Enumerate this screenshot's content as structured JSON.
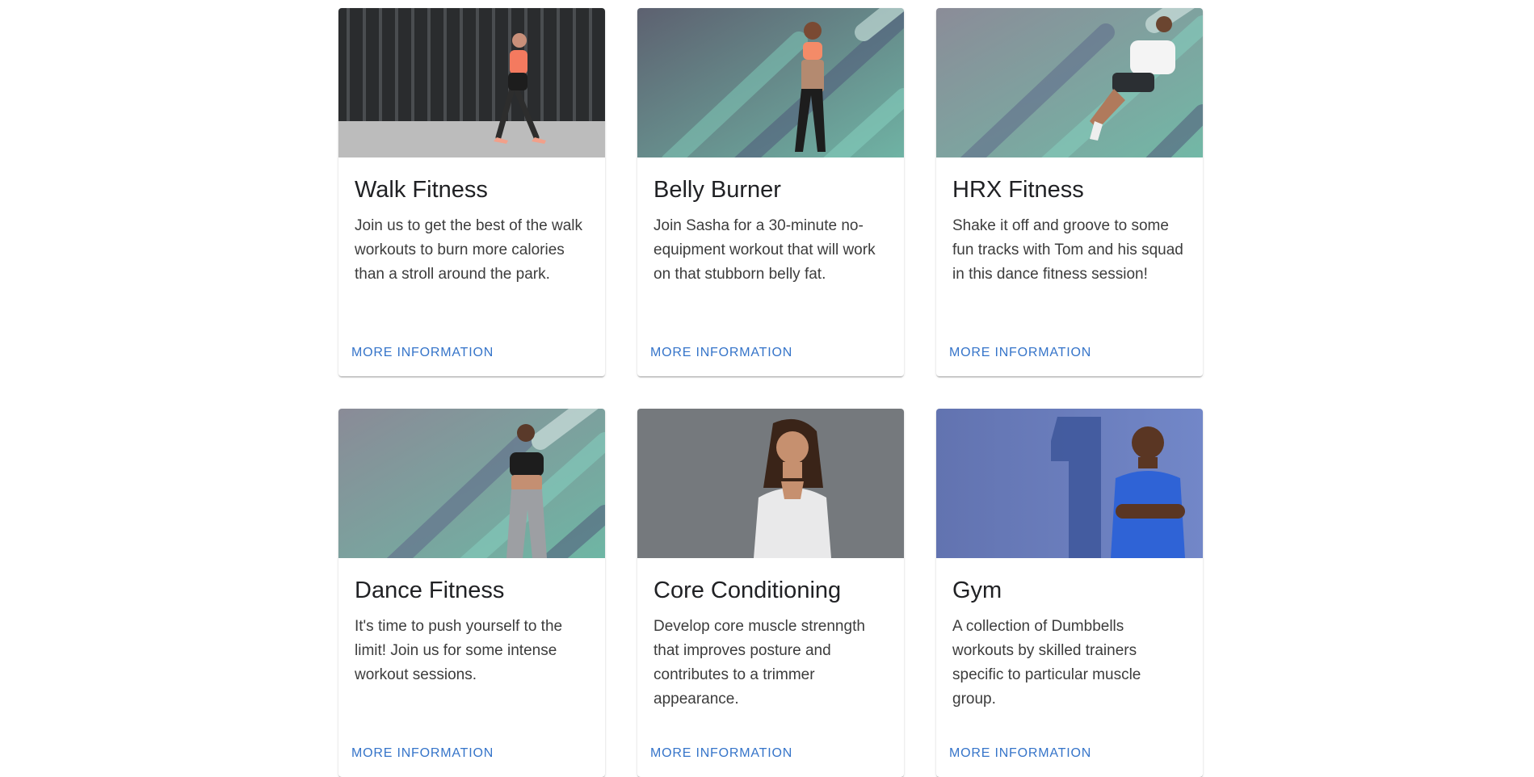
{
  "cards": [
    {
      "title": "Walk Fitness",
      "description": "Join us to get the best of the walk workouts to burn more calories than a stroll around the park.",
      "action": "MORE INFORMATION"
    },
    {
      "title": "Belly Burner",
      "description": "Join Sasha for a 30-minute no-equipment workout that will work on that stubborn belly fat.",
      "action": "MORE INFORMATION"
    },
    {
      "title": "HRX Fitness",
      "description": "Shake it off and groove to some fun tracks with Tom and his squad in this dance fitness session!",
      "action": "MORE INFORMATION"
    },
    {
      "title": "Dance Fitness",
      "description": "It's time to push yourself to the limit! Join us for some intense workout sessions.",
      "action": "MORE INFORMATION"
    },
    {
      "title": "Core Conditioning",
      "description": "Develop core muscle strenngth that improves posture and contributes to a trimmer appearance.",
      "action": "MORE INFORMATION"
    },
    {
      "title": "Gym",
      "description": "A collection of Dumbbells workouts by skilled trainers specific to particular muscle group.",
      "action": "MORE INFORMATION"
    }
  ],
  "colors": {
    "link": "#3574c9",
    "title": "#202124",
    "text": "#3c3c3c"
  }
}
